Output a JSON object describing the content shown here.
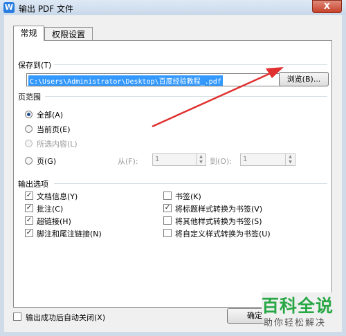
{
  "window": {
    "title": "输出 PDF 文件",
    "app_icon": "W",
    "close_glyph": "X"
  },
  "tabs": [
    {
      "label": "常规",
      "active": true
    },
    {
      "label": "权限设置",
      "active": false
    }
  ],
  "save_to": {
    "group_label": "保存到(T)",
    "path": "C:\\Users\\Administrator\\Desktop\\百度经验教程_.pdf",
    "browse_label": "浏览(B)..."
  },
  "page_range": {
    "group_label": "页范围",
    "options": [
      {
        "label": "全部(A)",
        "selected": true,
        "disabled": false
      },
      {
        "label": "当前页(E)",
        "selected": false,
        "disabled": false
      },
      {
        "label": "所选内容(L)",
        "selected": false,
        "disabled": true
      },
      {
        "label": "页(G)",
        "selected": false,
        "disabled": false
      }
    ],
    "from_label": "从(F):",
    "from_value": "1",
    "to_label": "到(O):",
    "to_value": "1"
  },
  "output_options": {
    "group_label": "输出选项",
    "left": [
      {
        "label": "文档信息(Y)",
        "checked": true
      },
      {
        "label": "批注(C)",
        "checked": true
      },
      {
        "label": "超链接(H)",
        "checked": true
      },
      {
        "label": "脚注和尾注链接(N)",
        "checked": true
      }
    ],
    "right": [
      {
        "label": "书签(K)",
        "checked": false
      },
      {
        "label": "将标题样式转换为书签(V)",
        "checked": true
      },
      {
        "label": "将其他样式转换为书签(S)",
        "checked": false
      },
      {
        "label": "将自定义样式转换为书签(U)",
        "checked": false
      }
    ]
  },
  "footer": {
    "auto_close_label": "输出成功后自动关闭(X)",
    "auto_close_checked": false,
    "ok_label": "确定"
  },
  "watermark": {
    "title": "百科全说",
    "subtitle": "助你轻松解决"
  },
  "colors": {
    "arrow": "#e03030",
    "selection": "#3399ff"
  }
}
